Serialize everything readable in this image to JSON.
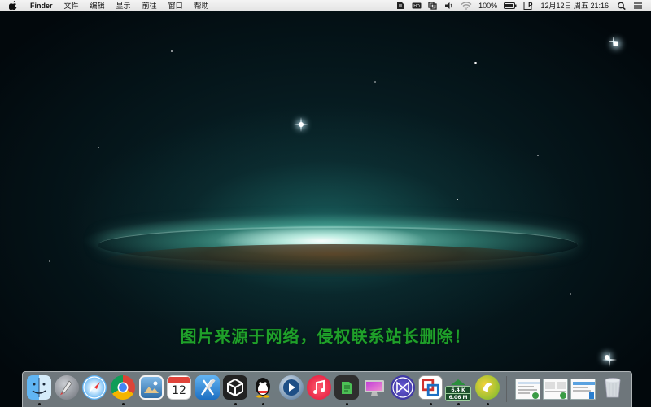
{
  "menubar": {
    "app_name": "Finder",
    "menus": [
      "文件",
      "编辑",
      "显示",
      "前往",
      "窗口",
      "帮助"
    ],
    "status": {
      "battery": "100%",
      "datetime": "12月12日 周五  21:16",
      "input_method": "P"
    }
  },
  "desktop": {
    "watermark": "图片来源于网络，侵权联系站长删除！"
  },
  "dock": {
    "netspeed_up": "6.4 K",
    "netspeed_down": "6.06 M",
    "calendar_day": "12"
  },
  "colors": {
    "watermark": "#1fa02a",
    "menubar_bg": "#ececec"
  }
}
